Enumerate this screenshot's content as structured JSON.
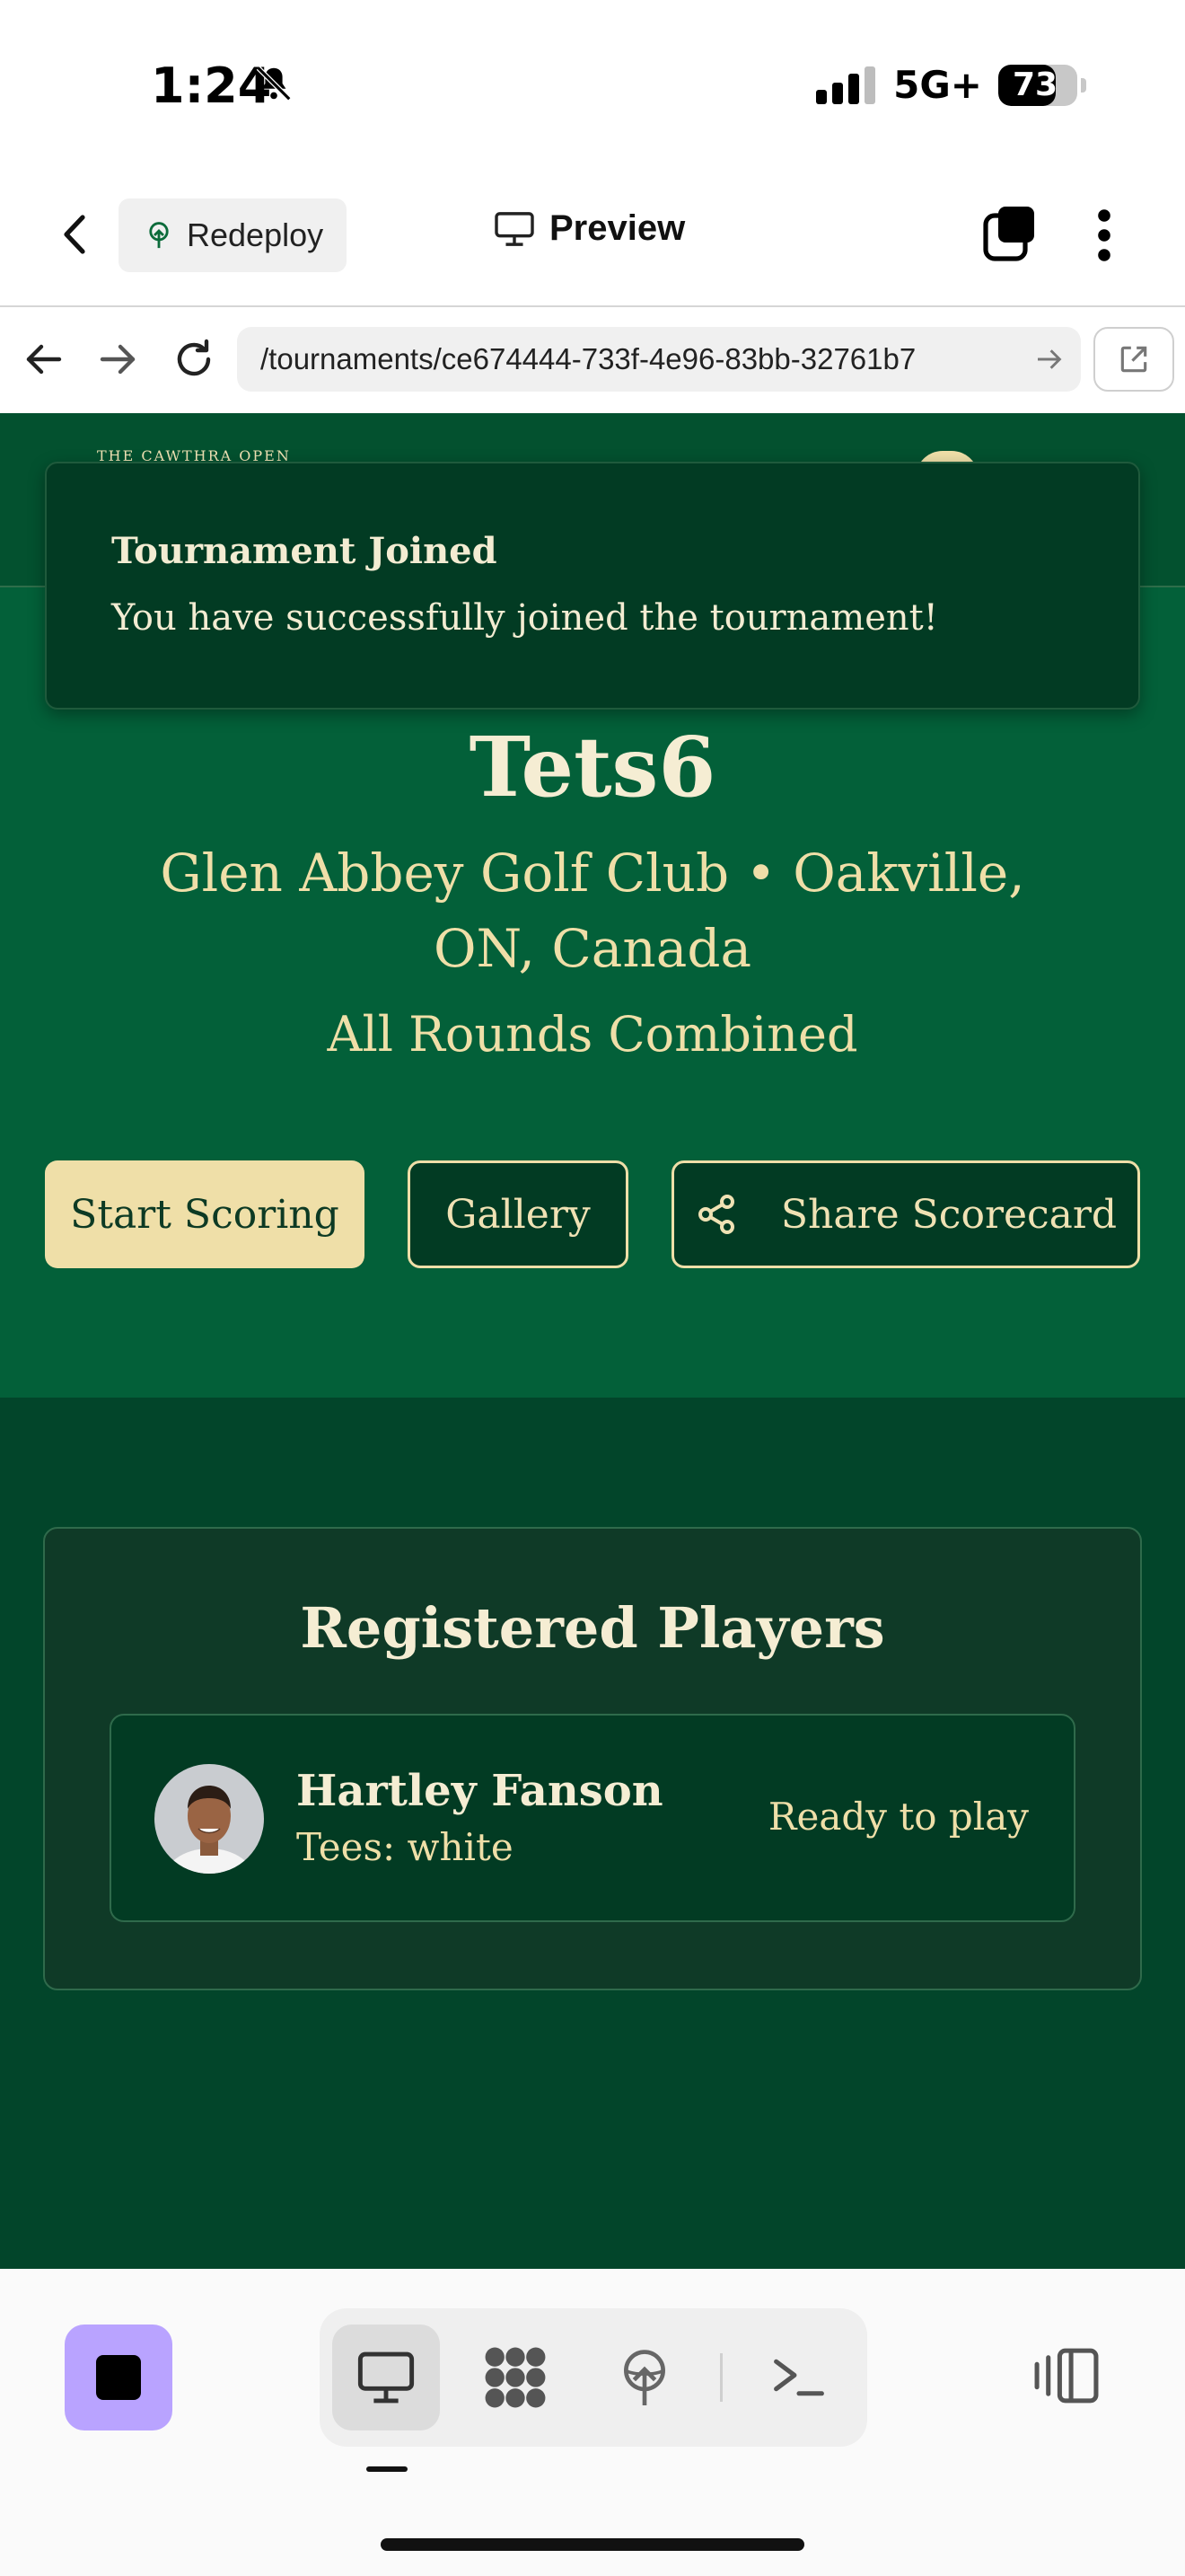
{
  "status_bar": {
    "time": "1:24",
    "network": "5G+",
    "battery": "73",
    "battery_level": 0.73
  },
  "nav": {
    "redeploy_label": "Redeploy",
    "preview_label": "Preview"
  },
  "browser": {
    "url": "/tournaments/ce674444-733f-4e96-83bb-32761b7"
  },
  "header": {
    "logo_text": "THE CAWTHRA OPEN"
  },
  "toast": {
    "title": "Tournament Joined",
    "message": "You have successfully joined the tournament!"
  },
  "tournament": {
    "name": "Tets6",
    "venue": "Glen Abbey Golf Club • Oakville, ON, Canada",
    "rounds": "All Rounds Combined"
  },
  "actions": {
    "start_scoring": "Start Scoring",
    "gallery": "Gallery",
    "share_scorecard": "Share Scorecard"
  },
  "players": {
    "title": "Registered Players",
    "items": [
      {
        "name": "Hartley Fanson",
        "tees": "Tees: white",
        "status": "Ready to play"
      }
    ]
  },
  "colors": {
    "hero": "#036039",
    "dark": "#02452a",
    "accent": "#efdfa8",
    "stop_button": "#b9a3ff"
  },
  "toolbar": {
    "icons": [
      "desktop-icon",
      "grid-dots-icon",
      "deploy-icon",
      "terminal-icon"
    ]
  }
}
